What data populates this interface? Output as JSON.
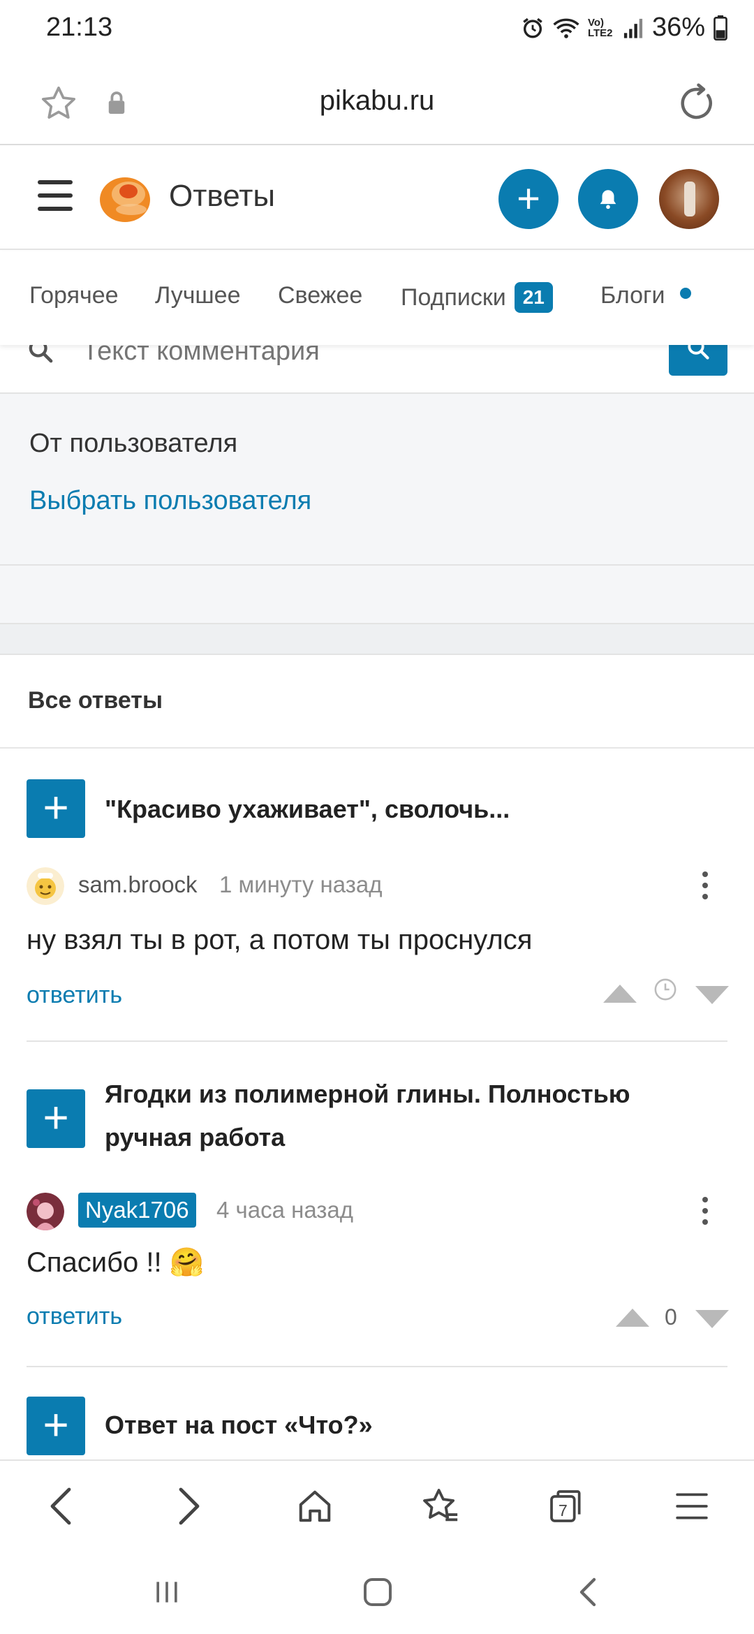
{
  "status_bar": {
    "time": "21:13",
    "battery": "36%",
    "network": "Vo) LTE2"
  },
  "browser": {
    "url": "pikabu.ru"
  },
  "header": {
    "title": "Ответы"
  },
  "tabs": [
    {
      "label": "Горячее"
    },
    {
      "label": "Лучшее"
    },
    {
      "label": "Свежее"
    },
    {
      "label": "Подписки",
      "count": "21"
    },
    {
      "label": "Блоги"
    }
  ],
  "search": {
    "placeholder": "Текст комментария"
  },
  "from_user": {
    "title": "От пользователя",
    "link": "Выбрать пользователя"
  },
  "answers": {
    "title": "Все ответы"
  },
  "comments": [
    {
      "post_title": "\"Красиво ухаживает\", сволочь...",
      "author": "sam.broock",
      "time": "1 минуту назад",
      "text": "ну взял ты в рот, а потом ты проснулся",
      "reply": "ответить"
    },
    {
      "post_title": "Ягодки из полимерной глины. Полностью ручная работа",
      "author": "Nyak1706",
      "time": "4 часа назад",
      "text": "Спасибо !! 🤗",
      "reply": "ответить",
      "votes": "0"
    },
    {
      "post_title": "Ответ на пост «Что?»"
    }
  ],
  "bottom_nav": {
    "tabs_count": "7"
  },
  "colors": {
    "accent": "#0a7cb0",
    "logo_orange": "#f08a24",
    "vote_grey": "#b9b9b9"
  }
}
